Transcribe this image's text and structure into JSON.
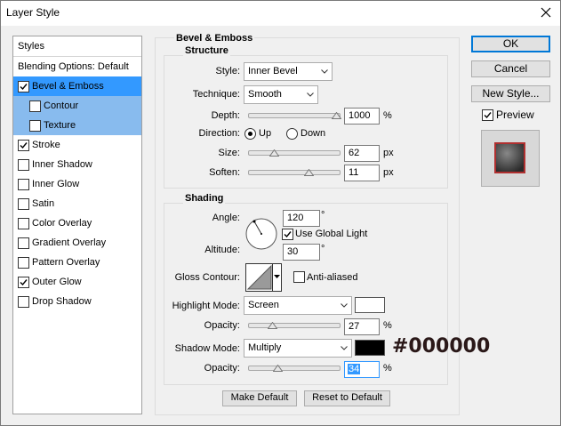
{
  "window": {
    "title": "Layer Style"
  },
  "styles_list": {
    "header": "Styles",
    "blending_options": "Blending Options: Default",
    "items": [
      {
        "label": "Bevel & Emboss",
        "checked": true
      },
      {
        "label": "Contour",
        "checked": false
      },
      {
        "label": "Texture",
        "checked": false
      },
      {
        "label": "Stroke",
        "checked": true
      },
      {
        "label": "Inner Shadow",
        "checked": false
      },
      {
        "label": "Inner Glow",
        "checked": false
      },
      {
        "label": "Satin",
        "checked": false
      },
      {
        "label": "Color Overlay",
        "checked": false
      },
      {
        "label": "Gradient Overlay",
        "checked": false
      },
      {
        "label": "Pattern Overlay",
        "checked": false
      },
      {
        "label": "Outer Glow",
        "checked": true
      },
      {
        "label": "Drop Shadow",
        "checked": false
      }
    ]
  },
  "bevel": {
    "heading": "Bevel & Emboss",
    "structure": {
      "heading": "Structure",
      "style_label": "Style:",
      "style_value": "Inner Bevel",
      "technique_label": "Technique:",
      "technique_value": "Smooth",
      "depth_label": "Depth:",
      "depth_value": "1000",
      "depth_fraction": 1.0,
      "direction_label": "Direction:",
      "direction_up": "Up",
      "direction_down": "Down",
      "size_label": "Size:",
      "size_value": "62",
      "size_fraction": 0.25,
      "soften_label": "Soften:",
      "soften_value": "11",
      "soften_fraction": 0.65,
      "pct_unit": "%",
      "px_unit": "px"
    },
    "shading": {
      "heading": "Shading",
      "angle_label": "Angle:",
      "angle_value": "120",
      "degree": "°",
      "use_global_light": "Use Global Light",
      "altitude_label": "Altitude:",
      "altitude_value": "30",
      "gloss_label": "Gloss Contour:",
      "anti_aliased": "Anti-aliased",
      "highlight_label": "Highlight Mode:",
      "highlight_value": "Screen",
      "highlight_color": "#ffffff",
      "hl_opacity_label": "Opacity:",
      "hl_opacity_value": "27",
      "hl_opacity_fraction": 0.27,
      "shadow_label": "Shadow Mode:",
      "shadow_value": "Multiply",
      "shadow_color": "#000000",
      "shadow_color_hex": "#000000",
      "sh_opacity_label": "Opacity:",
      "sh_opacity_value": "34",
      "sh_opacity_fraction": 0.34,
      "pct_unit": "%"
    },
    "make_default": "Make Default",
    "reset_default": "Reset to Default"
  },
  "buttons": {
    "ok": "OK",
    "cancel": "Cancel",
    "new_style": "New Style...",
    "preview": "Preview"
  }
}
